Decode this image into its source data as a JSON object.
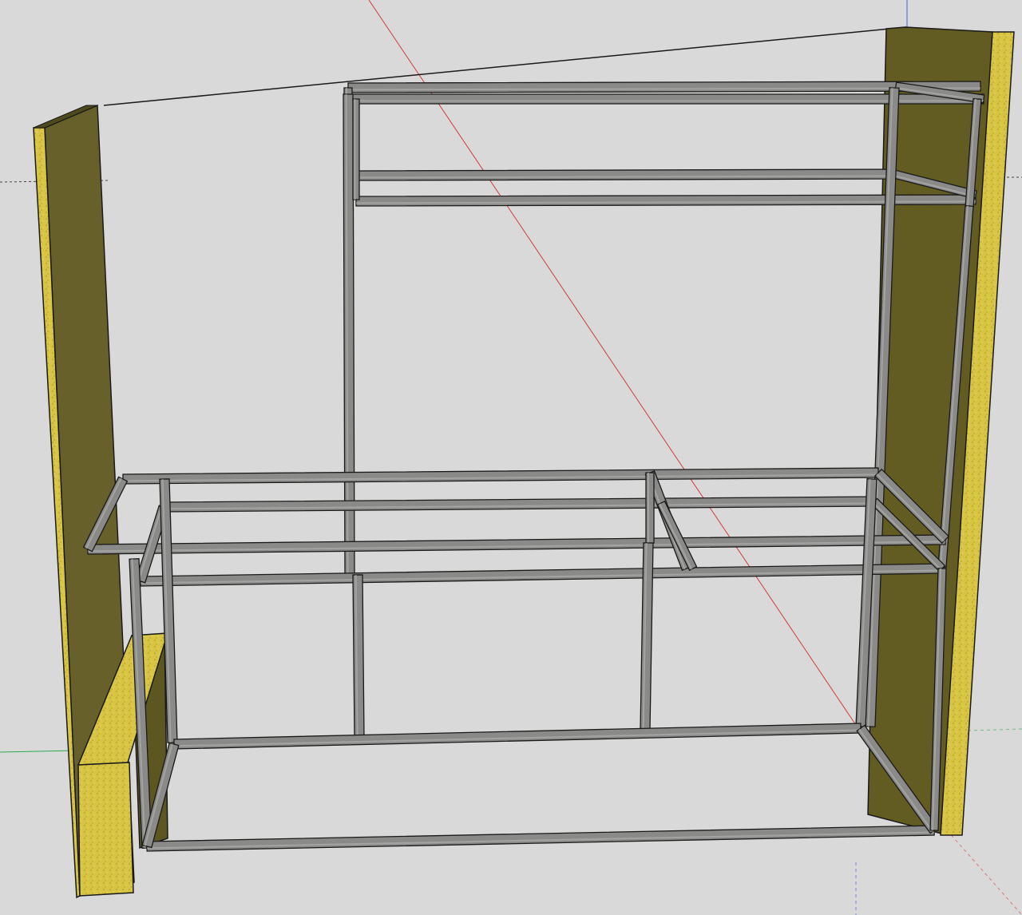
{
  "scene": {
    "background": "#d9d9d9",
    "axis_colors": {
      "red": "#d23a3a",
      "green": "#2fa84f",
      "blue": "#3d5fd8"
    },
    "materials": {
      "panel_face": "#6b6428",
      "panel_face_dark": "#5c5620",
      "panel_edge": "#d8c544",
      "panel_edge_speckle": "#b8a52e",
      "steel": "#8a8a88",
      "steel_light": "#b5b5b2",
      "steel_dark": "#5e5e5c",
      "outline": "#1a1a1a"
    },
    "objects": [
      "left-side-panel",
      "right-side-panel",
      "left-low-block",
      "steel-tube-frame",
      "guide-line"
    ]
  }
}
